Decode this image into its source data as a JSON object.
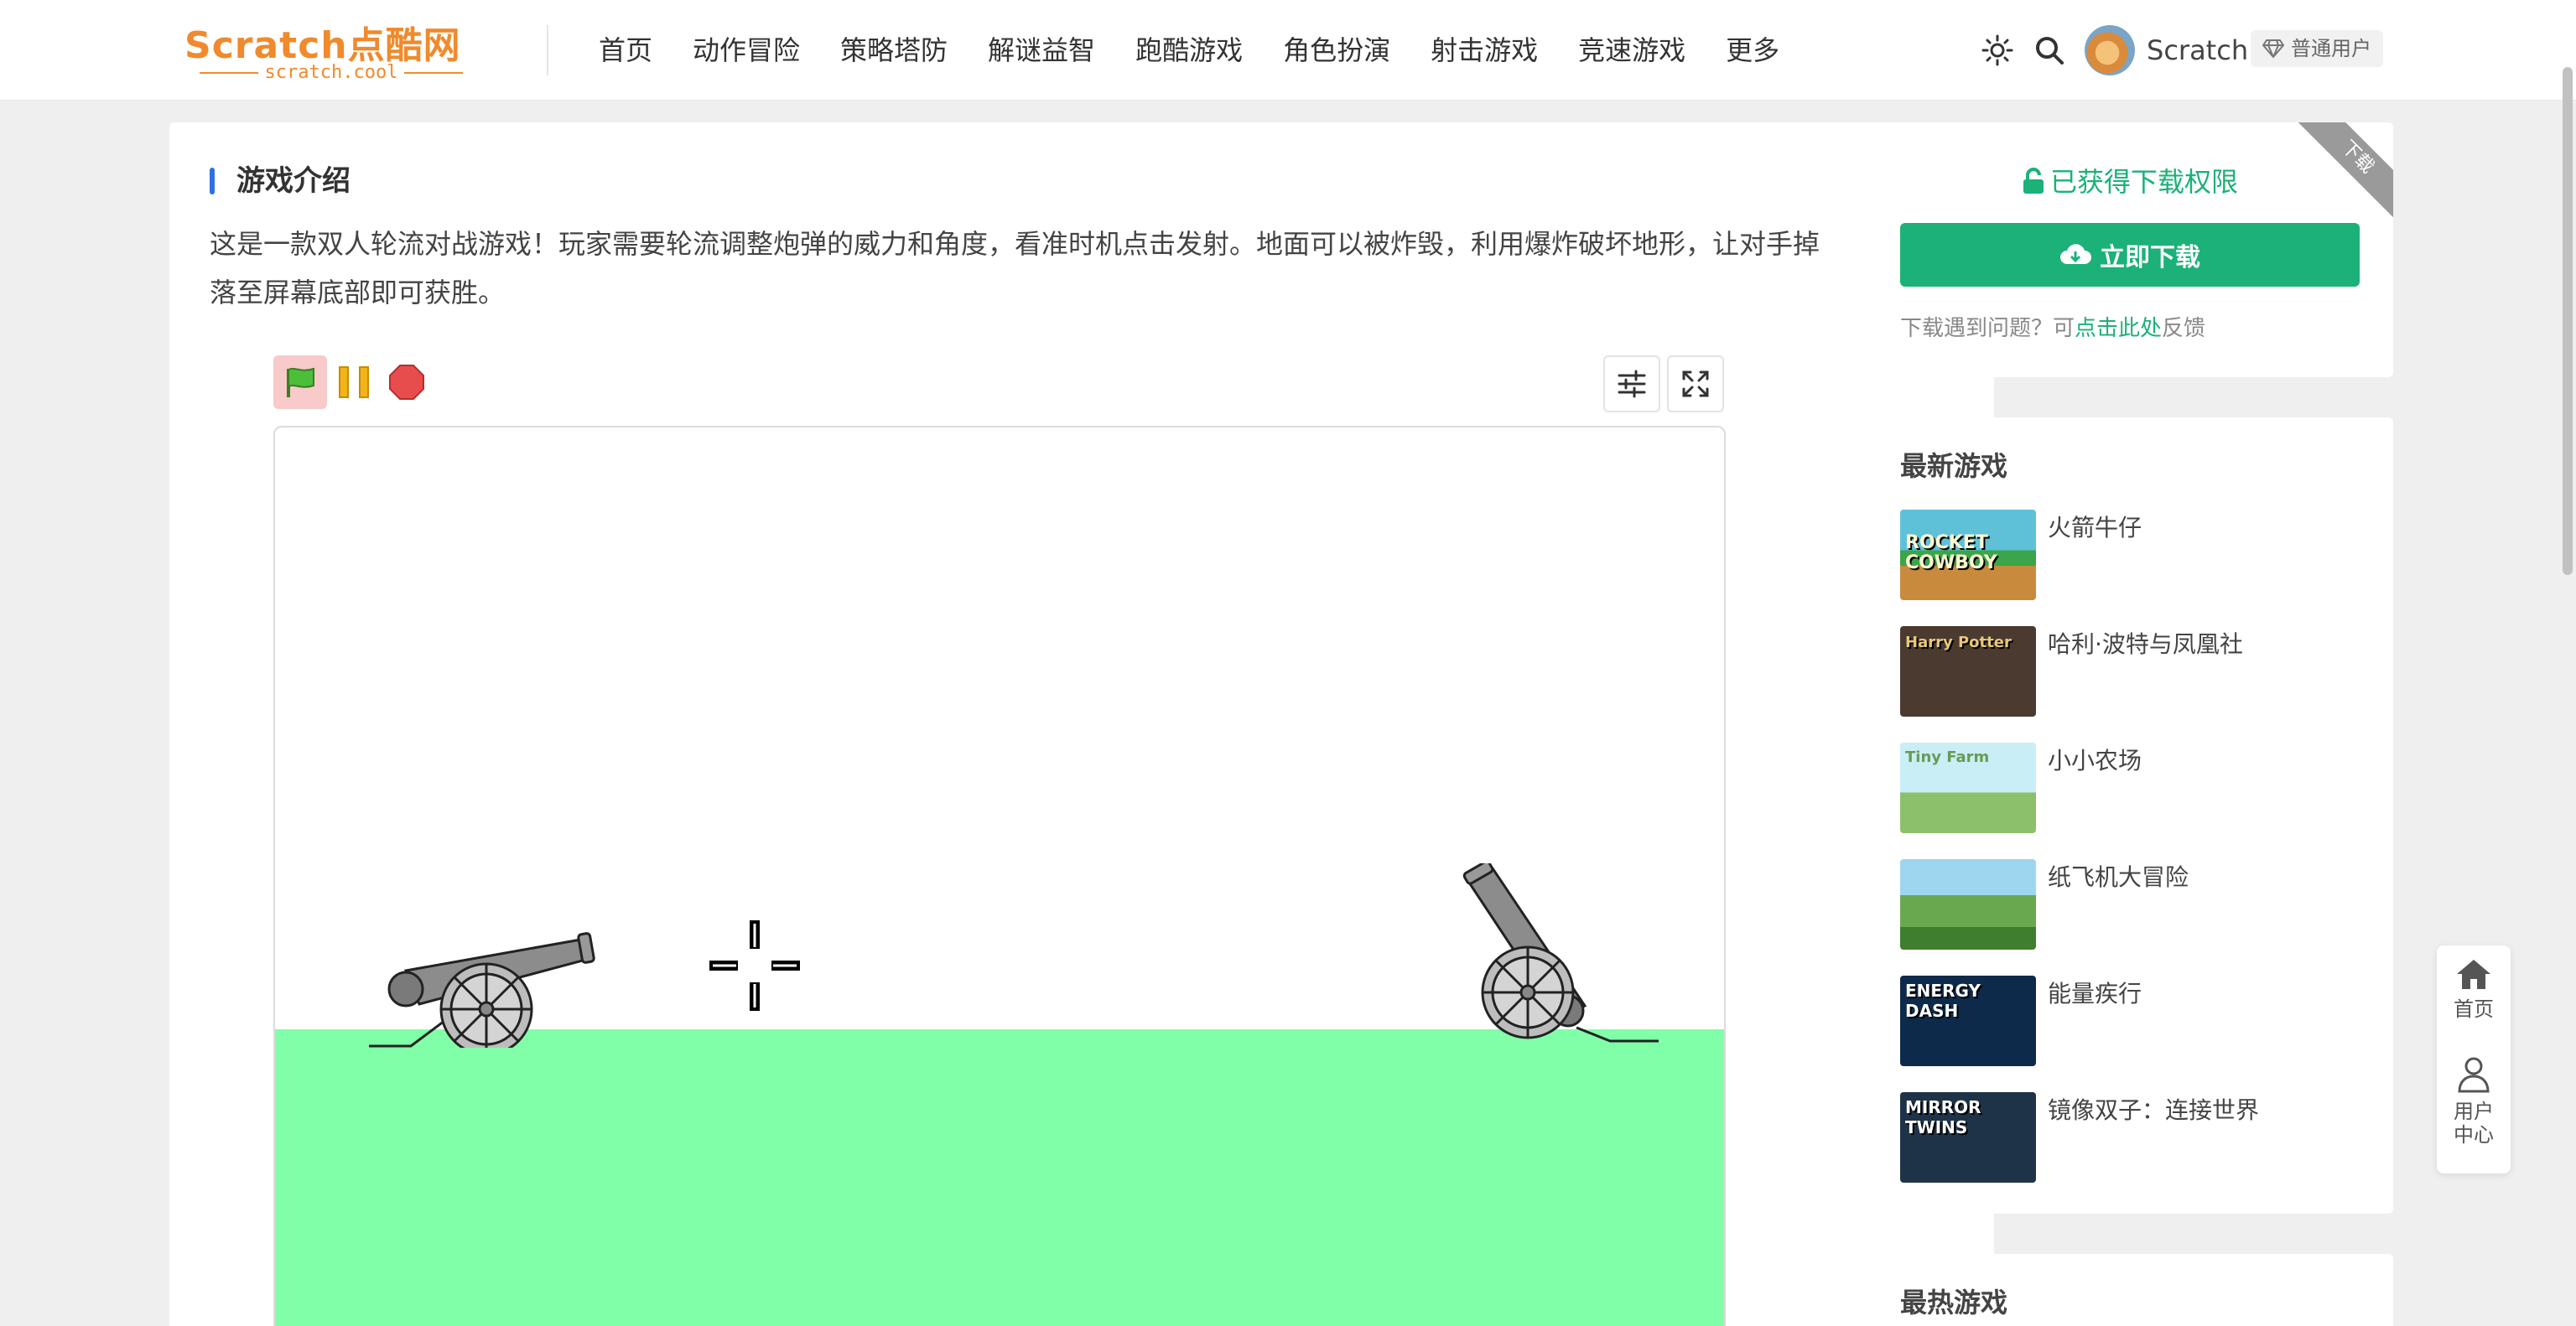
{
  "header": {
    "logo_main": "Scratch点酷网",
    "logo_sub": "scratch.cool",
    "nav": [
      "首页",
      "动作冒险",
      "策略塔防",
      "解谜益智",
      "跑酷游戏",
      "角色扮演",
      "射击游戏",
      "竞速游戏",
      "更多"
    ],
    "username": "Scratch",
    "role": "普通用户"
  },
  "main": {
    "section_title": "游戏介绍",
    "intro": "这是一款双人轮流对战游戏！玩家需要轮流调整炮弹的威力和角度，看准时机点击发射。地面可以被炸毁，利用爆炸破坏地形，让对手掉落至屏幕底部即可获胜。"
  },
  "download": {
    "ribbon": "下载",
    "permission": "已获得下载权限",
    "button": "立即下载",
    "help_prefix": "下载遇到问题？可",
    "help_link": "点击此处",
    "help_suffix": "反馈"
  },
  "latest": {
    "title": "最新游戏",
    "games": [
      {
        "name": "火箭牛仔",
        "thumb_text": "ROCKET COWBOY"
      },
      {
        "name": "哈利·波特与凤凰社",
        "thumb_text": "Harry Potter"
      },
      {
        "name": "小小农场",
        "thumb_text": "Tiny Farm"
      },
      {
        "name": "纸飞机大冒险",
        "thumb_text": ""
      },
      {
        "name": "能量疾行",
        "thumb_text": "ENERGY DASH"
      },
      {
        "name": "镜像双子：连接世界",
        "thumb_text": "MIRROR TWINS"
      }
    ]
  },
  "hot": {
    "title": "最热游戏"
  },
  "float": {
    "home": "首页",
    "user": "用户中心"
  },
  "colors": {
    "accent_green": "#1bb178",
    "logo_orange": "#f08a2c",
    "title_bar_blue": "#2f6fe4",
    "ground_green": "#80ffa8"
  }
}
